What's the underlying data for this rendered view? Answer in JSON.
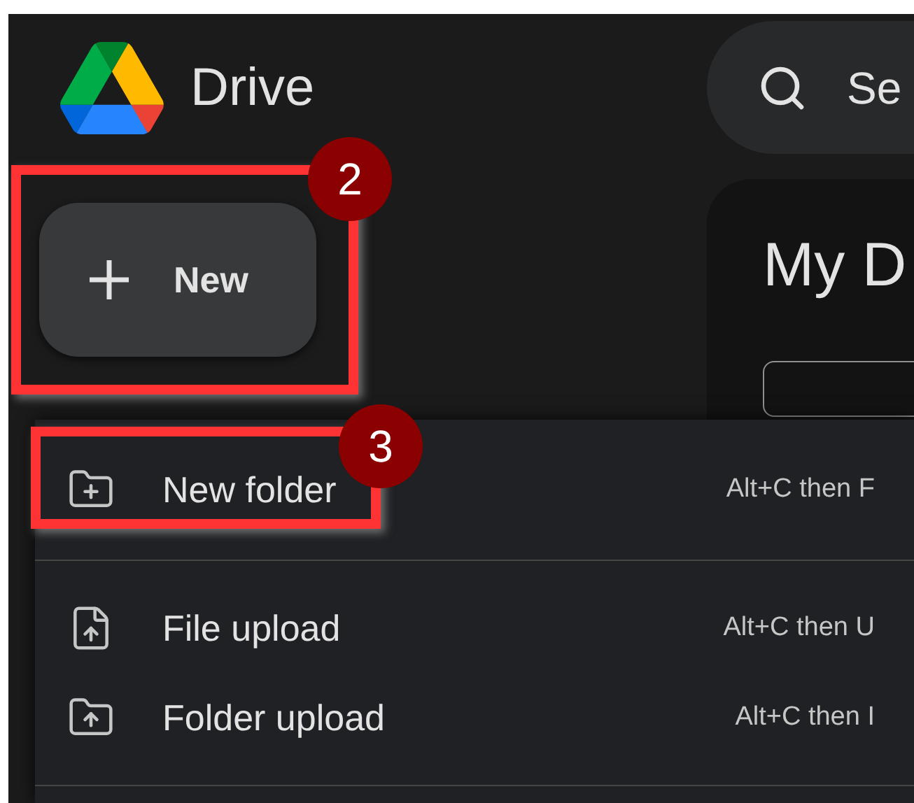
{
  "app": {
    "name": "Drive"
  },
  "new_button": {
    "label": "New"
  },
  "search": {
    "placeholder": "Se"
  },
  "main": {
    "heading": "My D"
  },
  "menu": {
    "groups": [
      [
        {
          "kind": "new-folder",
          "label": "New folder",
          "shortcut": "Alt+C then F"
        }
      ],
      [
        {
          "kind": "file-upload",
          "label": "File upload",
          "shortcut": "Alt+C then U"
        },
        {
          "kind": "folder-upload",
          "label": "Folder upload",
          "shortcut": "Alt+C then I"
        }
      ]
    ]
  },
  "annotations": [
    {
      "label": "2"
    },
    {
      "label": "3"
    }
  ]
}
